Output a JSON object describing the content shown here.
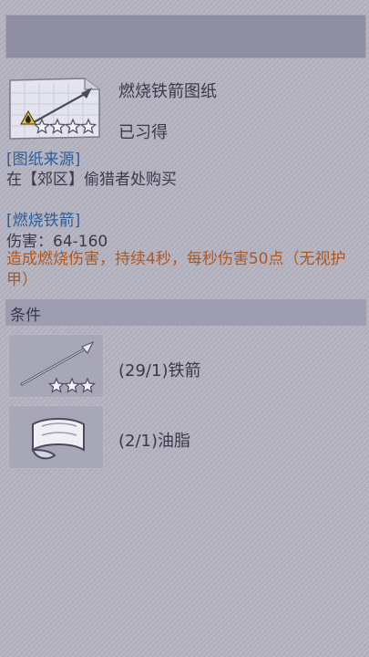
{
  "item": {
    "name": "燃烧铁箭图纸",
    "status": "已习得",
    "rarity_stars": 4
  },
  "source": {
    "heading": "[图纸来源]",
    "text": "在【郊区】偷猎者处购买"
  },
  "details": {
    "heading": "[燃烧铁箭]",
    "damage": "伤害：64-160",
    "effect": "造成燃烧伤害，持续4秒，每秒伤害50点（无视护甲）"
  },
  "conditions": {
    "label": "条件",
    "materials": [
      {
        "icon": "iron-arrow-icon",
        "label": "(29/1)铁箭",
        "stars": 3
      },
      {
        "icon": "grease-icon",
        "label": "(2/1)油脂",
        "stars": 0
      }
    ]
  },
  "colors": {
    "heading": "#2d5f97",
    "effect": "#b0571b",
    "text": "#3a394c"
  }
}
